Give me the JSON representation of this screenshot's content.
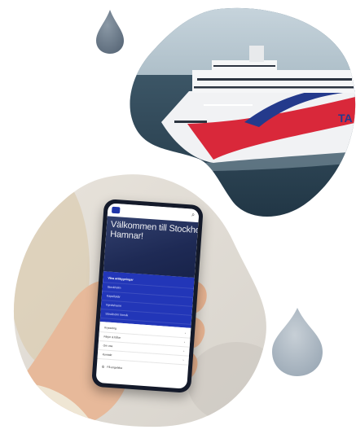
{
  "phone_screen": {
    "hero_title": "Välkommen till Stockholms Hamnar!",
    "menu_items": [
      "Våra anläggningar",
      "Stockholm",
      "Kapellskär",
      "Nynäshamn",
      "Stockholm Norvik"
    ],
    "list_items": [
      "Kryssning",
      "Färjor & båtar",
      "Om oss",
      "Kontakt"
    ],
    "language": "På engelska"
  },
  "colors": {
    "menu_blue": "#2236b8",
    "ship_red": "#d9283a",
    "ship_navy": "#243a8c",
    "drop_gray": "#6f7f90"
  }
}
